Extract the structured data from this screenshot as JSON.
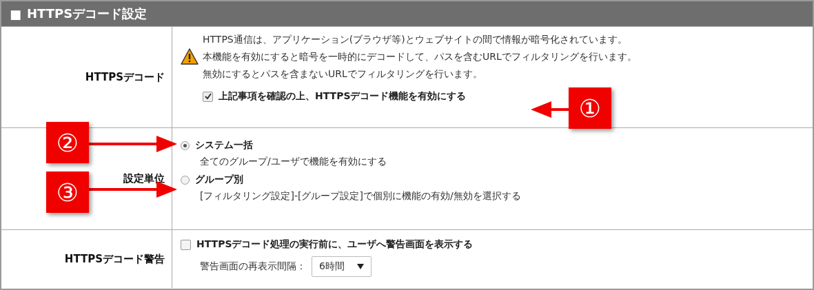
{
  "header": {
    "bullet": "■",
    "title": "HTTPSデコード設定"
  },
  "rows": [
    {
      "kind": "decode",
      "label": "HTTPSデコード",
      "notes": [
        "HTTPS通信は、アプリケーション(ブラウザ等)とウェブサイトの間で情報が暗号化されています。",
        "本機能を有効にすると暗号を一時的にデコードして、パスを含むURLでフィルタリングを行います。",
        "無効にするとパスを含まないURLでフィルタリングを行います。"
      ],
      "checkbox": {
        "label": "上記事項を確認の上、HTTPSデコード機能を有効にする",
        "checked": true
      }
    },
    {
      "kind": "radio",
      "label": "設定単位",
      "options": [
        {
          "label": "システム一括",
          "description": "全てのグループ/ユーザで機能を有効にする",
          "selected": true
        },
        {
          "label": "グループ別",
          "description": "[フィルタリング設定]-[グループ設定]で個別に機能の有効/無効を選択する",
          "selected": false
        }
      ]
    },
    {
      "kind": "warning",
      "label": "HTTPSデコード警告",
      "checkbox": {
        "label": "HTTPSデコード処理の実行前に、ユーザへ警告画面を表示する",
        "checked": false
      },
      "interval": {
        "label": "警告画面の再表示間隔：",
        "value": "6時間"
      }
    }
  ],
  "callouts": [
    {
      "number": "①"
    },
    {
      "number": "②"
    },
    {
      "number": "③"
    }
  ]
}
